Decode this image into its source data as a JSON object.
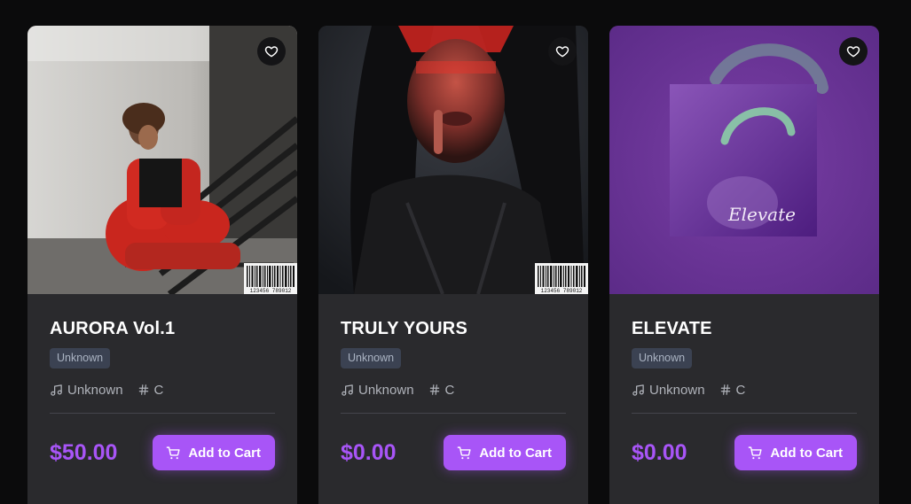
{
  "colors": {
    "accent": "#a855f7",
    "card_bg": "#2a2a2d",
    "page_bg": "#0b0b0c",
    "tag_bg": "#3b4252"
  },
  "products": [
    {
      "title": "AURORA Vol.1",
      "tag": "Unknown",
      "artist": "Unknown",
      "key": "C",
      "price": "$50.00",
      "cart_label": "Add to Cart",
      "barcode_text": "123456 789012",
      "icons": [
        "heart-icon",
        "music-note-icon",
        "hash-icon",
        "cart-icon"
      ]
    },
    {
      "title": "TRULY YOURS",
      "tag": "Unknown",
      "artist": "Unknown",
      "key": "C",
      "price": "$0.00",
      "cart_label": "Add to Cart",
      "barcode_text": "123456 789012",
      "icons": [
        "heart-icon",
        "music-note-icon",
        "hash-icon",
        "cart-icon"
      ]
    },
    {
      "title": "ELEVATE",
      "tag": "Unknown",
      "artist": "Unknown",
      "key": "C",
      "price": "$0.00",
      "cart_label": "Add to Cart",
      "cover_text": "Elevate",
      "icons": [
        "heart-icon",
        "music-note-icon",
        "hash-icon",
        "cart-icon"
      ]
    }
  ]
}
